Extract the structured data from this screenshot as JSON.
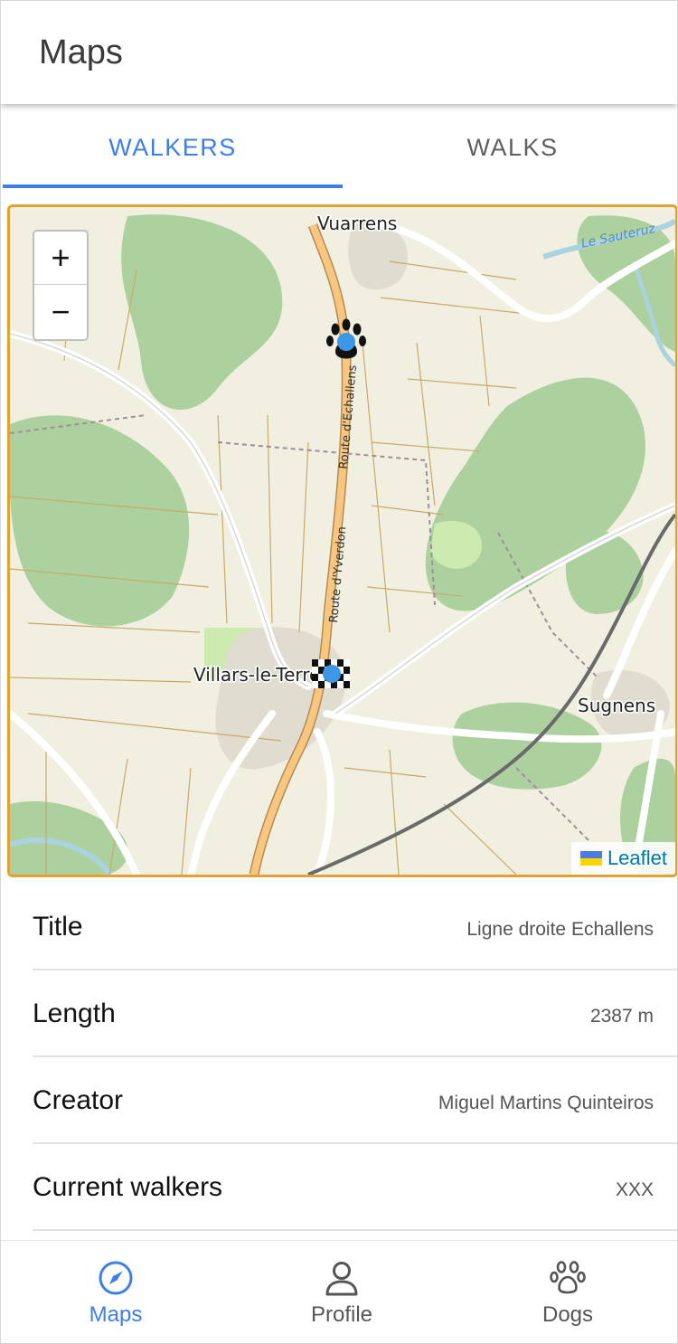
{
  "app": {
    "title": "Maps"
  },
  "tabs": [
    {
      "label": "WALKERS",
      "active": true
    },
    {
      "label": "WALKS",
      "active": false
    }
  ],
  "map": {
    "zoom_in": "+",
    "zoom_out": "−",
    "attribution": "Leaflet",
    "places": [
      "Vuarrens",
      "Villars-le-Terroir",
      "Sugnens",
      "Le Sauteruz"
    ],
    "road_labels": [
      "Route d'Echallens",
      "Route d'Yverdon"
    ],
    "markers": [
      "walker-paw-marker",
      "finish-flag-marker"
    ],
    "accent_color": "#e1a233",
    "marker_color": "#3d96e6"
  },
  "details": [
    {
      "label": "Title",
      "value": "Ligne droite Echallens"
    },
    {
      "label": "Length",
      "value": "2387 m"
    },
    {
      "label": "Creator",
      "value": "Miguel Martins Quinteiros"
    },
    {
      "label": "Current walkers",
      "value": "XXX"
    }
  ],
  "bottom_nav": [
    {
      "label": "Maps",
      "icon": "navigation-icon",
      "active": true
    },
    {
      "label": "Profile",
      "icon": "person-icon",
      "active": false
    },
    {
      "label": "Dogs",
      "icon": "paw-icon",
      "active": false
    }
  ],
  "colors": {
    "primary": "#3d7fe6",
    "text_muted": "#555555"
  }
}
